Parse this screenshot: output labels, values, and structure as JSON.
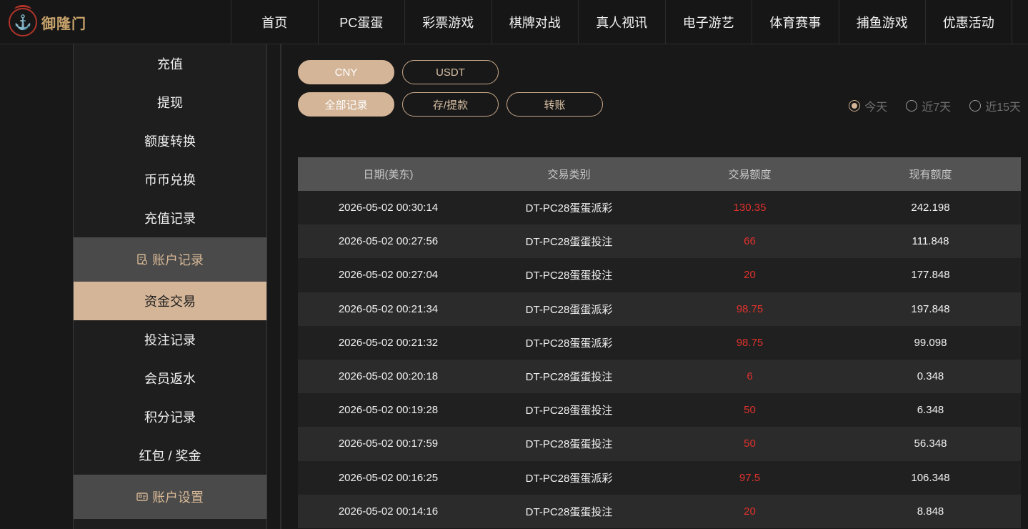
{
  "brand": {
    "name": "御隆门"
  },
  "nav": [
    "首页",
    "PC蛋蛋",
    "彩票游戏",
    "棋牌对战",
    "真人视讯",
    "电子游艺",
    "体育赛事",
    "捕鱼游戏",
    "优惠活动"
  ],
  "sidebar": {
    "items_top": [
      "充值",
      "提现",
      "额度转换",
      "币币兑换",
      "充值记录"
    ],
    "group_records": "账户记录",
    "items_records": [
      "资金交易",
      "投注记录",
      "会员返水",
      "积分记录",
      "红包 / 奖金"
    ],
    "group_settings": "账户设置",
    "active": "资金交易"
  },
  "currency_tabs": {
    "cny": "CNY",
    "usdt": "USDT",
    "selected": "CNY"
  },
  "record_tabs": {
    "all": "全部记录",
    "deposit_withdraw": "存/提款",
    "transfer": "转账",
    "selected": "全部记录"
  },
  "date_filter": {
    "today": "今天",
    "d7": "近7天",
    "d15": "近15天",
    "selected": "今天"
  },
  "table": {
    "headers": [
      "日期(美东)",
      "交易类别",
      "交易额度",
      "现有额度"
    ],
    "rows": [
      [
        "2026-05-02 00:30:14",
        "DT-PC28蛋蛋派彩",
        "130.35",
        "242.198"
      ],
      [
        "2026-05-02 00:27:56",
        "DT-PC28蛋蛋投注",
        "66",
        "111.848"
      ],
      [
        "2026-05-02 00:27:04",
        "DT-PC28蛋蛋投注",
        "20",
        "177.848"
      ],
      [
        "2026-05-02 00:21:34",
        "DT-PC28蛋蛋派彩",
        "98.75",
        "197.848"
      ],
      [
        "2026-05-02 00:21:32",
        "DT-PC28蛋蛋派彩",
        "98.75",
        "99.098"
      ],
      [
        "2026-05-02 00:20:18",
        "DT-PC28蛋蛋投注",
        "6",
        "0.348"
      ],
      [
        "2026-05-02 00:19:28",
        "DT-PC28蛋蛋投注",
        "50",
        "6.348"
      ],
      [
        "2026-05-02 00:17:59",
        "DT-PC28蛋蛋投注",
        "50",
        "56.348"
      ],
      [
        "2026-05-02 00:16:25",
        "DT-PC28蛋蛋派彩",
        "97.5",
        "106.348"
      ],
      [
        "2026-05-02 00:14:16",
        "DT-PC28蛋蛋投注",
        "20",
        "8.848"
      ]
    ]
  },
  "colors": {
    "accent": "#d4b598",
    "amount": "#e0312d",
    "brand_red": "#b0332a"
  }
}
